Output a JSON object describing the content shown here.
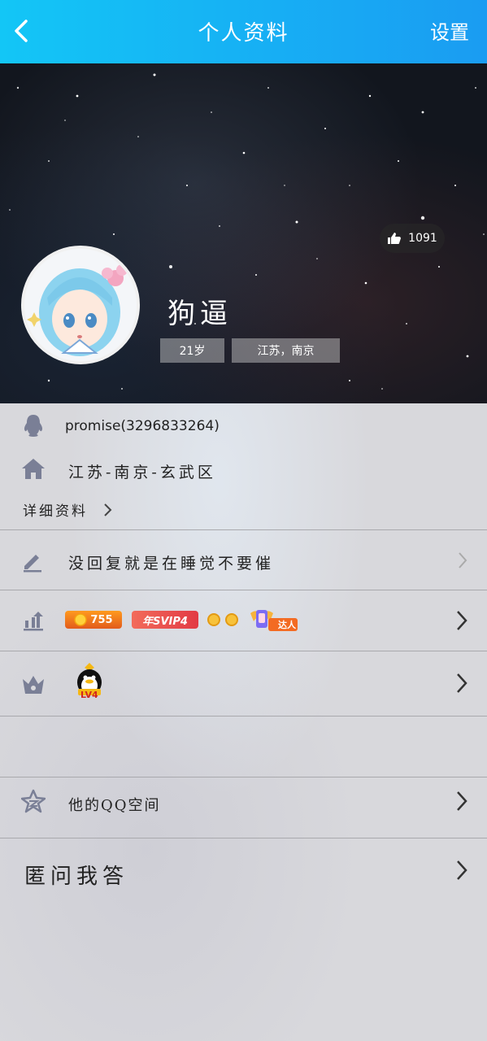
{
  "header": {
    "title": "个人资料",
    "settings_label": "设置"
  },
  "hero": {
    "likes_count": "1091",
    "nickname": "狗逼",
    "age_tag": "21岁",
    "location_tag": "江苏，南京"
  },
  "profile": {
    "qq_account": "promise(3296833264)",
    "hometown": "江苏-南京-玄武区",
    "details_link": "详细资料"
  },
  "signature": "没回复就是在睡觉不要催",
  "badges": {
    "coin_count": "755",
    "svip_label": "年SVIP4",
    "talent_label": "达人"
  },
  "level": {
    "qq_level_label": "LV4"
  },
  "qzone_label": "他的QQ空间",
  "anon_ask_label": "匿问我答",
  "colors": {
    "header_start": "#13c6f6",
    "header_end": "#1a9cf2",
    "icon_gray": "#7a7f96",
    "coin_orange": "#f5a20f",
    "svip_red": "#e23a44"
  }
}
